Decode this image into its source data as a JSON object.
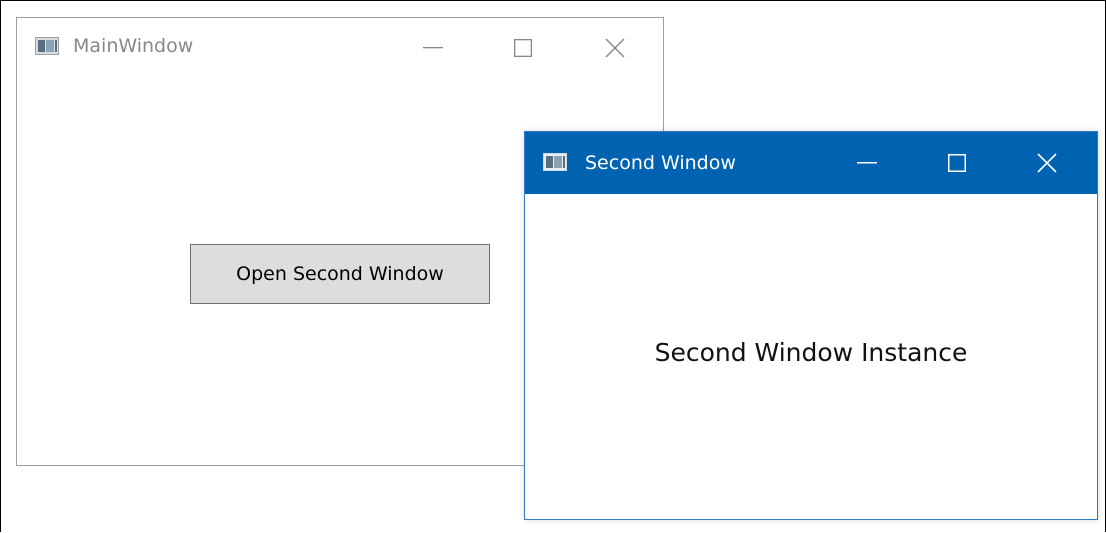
{
  "main_window": {
    "title": "MainWindow",
    "icon": "app-window-icon",
    "caption_buttons": [
      "minimize-icon",
      "maximize-icon",
      "close-icon"
    ],
    "open_button_label": "Open Second Window"
  },
  "second_window": {
    "title": "Second Window",
    "icon": "app-window-icon",
    "titlebar_color": "#0063b1",
    "caption_buttons": [
      "minimize-icon",
      "maximize-icon",
      "close-icon"
    ],
    "content_text": "Second Window Instance"
  }
}
